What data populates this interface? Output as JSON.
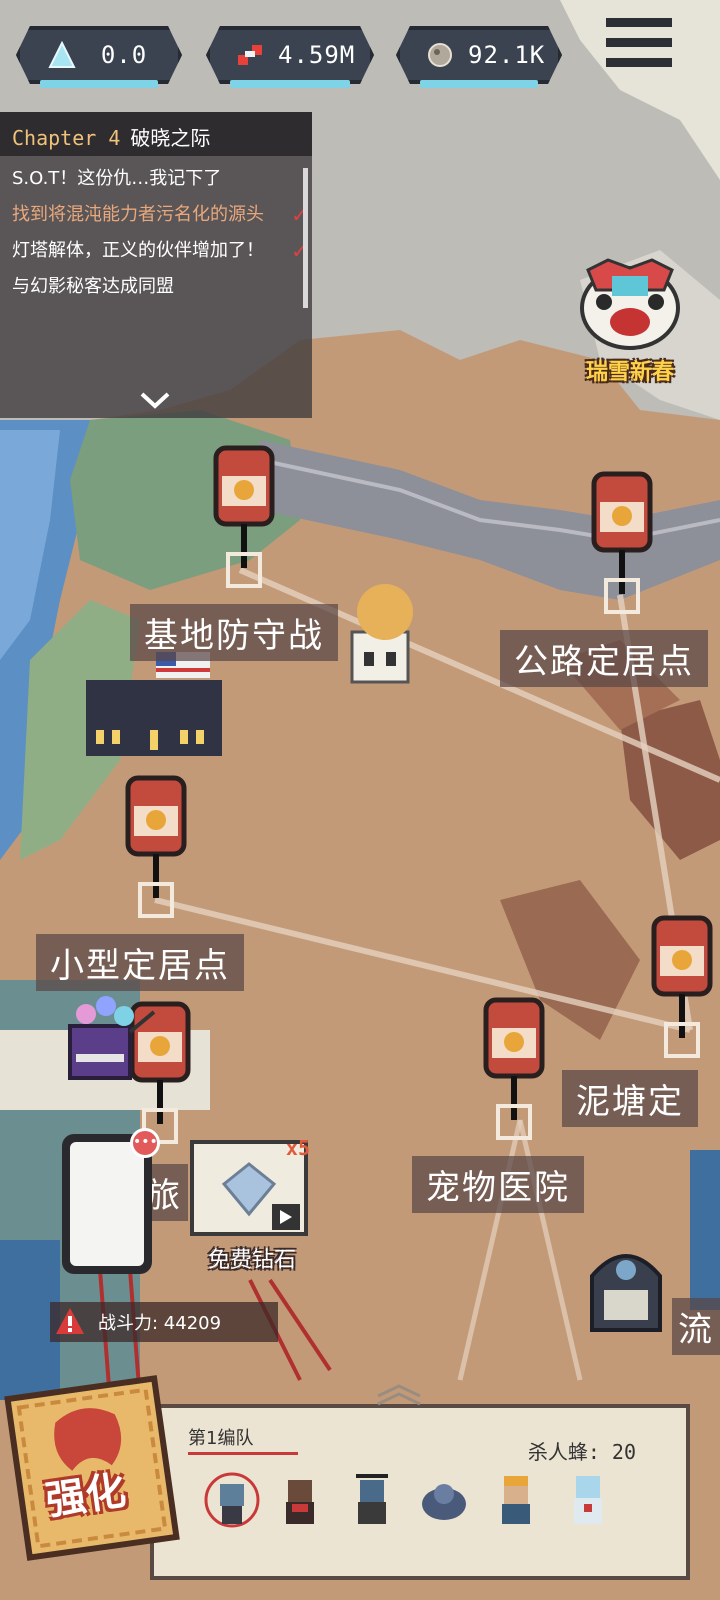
{
  "resources": [
    {
      "icon": "crystal-icon",
      "value": "0.0",
      "color": "#a8e4f2"
    },
    {
      "icon": "gene-icon",
      "value": "4.59M",
      "color": "#e8413a"
    },
    {
      "icon": "rock-icon",
      "value": "92.1K",
      "color": "#b0a89a"
    }
  ],
  "quest": {
    "chapter": "Chapter 4",
    "title": "破晓之际",
    "items": [
      {
        "text": "S.O.T！这份仇…我记下了",
        "done": false
      },
      {
        "text": "找到将混沌能力者污名化的源头",
        "done": true
      },
      {
        "text": "灯塔解体，正义的伙伴增加了！",
        "done": true
      },
      {
        "text": "与幻影秘客达成同盟",
        "done": false
      }
    ]
  },
  "event": {
    "label": "瑞雪新春"
  },
  "locations": [
    {
      "name": "基地防守战"
    },
    {
      "name": "公路定居点"
    },
    {
      "name": "小型定居点"
    },
    {
      "name": "泥塘定"
    },
    {
      "name": "宠物医院"
    },
    {
      "name": "旅"
    },
    {
      "name": "流"
    }
  ],
  "free_diamond": {
    "label": "免费钻石",
    "count": "x5"
  },
  "power": {
    "label": "战斗力: 44209"
  },
  "squad": {
    "name": "第1编队",
    "kills": "杀人蜂: 20"
  },
  "upgrade": {
    "label": "强化"
  }
}
